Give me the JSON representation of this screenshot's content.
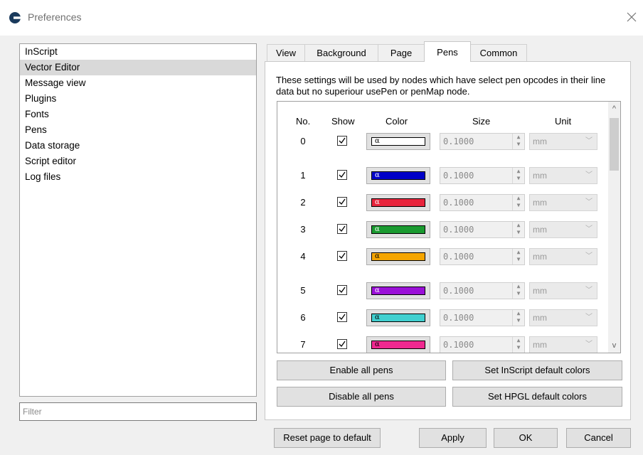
{
  "window": {
    "title": "Preferences"
  },
  "sidebar": {
    "items": [
      {
        "label": "InScript"
      },
      {
        "label": "Vector Editor",
        "selected": true
      },
      {
        "label": "Message view"
      },
      {
        "label": "Plugins"
      },
      {
        "label": "Fonts"
      },
      {
        "label": "Pens"
      },
      {
        "label": "Data storage"
      },
      {
        "label": "Script editor"
      },
      {
        "label": "Log files"
      }
    ],
    "filter_placeholder": "Filter"
  },
  "tabs": [
    {
      "label": "View"
    },
    {
      "label": "Background"
    },
    {
      "label": "Page"
    },
    {
      "label": "Pens",
      "active": true
    },
    {
      "label": "Common"
    }
  ],
  "pens_tab": {
    "description": "These settings will be used by nodes which have select pen opcodes in their line data but no superiour usePen or penMap node.",
    "headers": {
      "no": "No.",
      "show": "Show",
      "color": "Color",
      "size": "Size",
      "unit": "Unit"
    },
    "alpha_glyph": "α",
    "rows": [
      {
        "no": "0",
        "show": true,
        "color": "#ffffff",
        "size": "0.1000",
        "unit": "mm"
      },
      {
        "no": "1",
        "show": true,
        "color": "#0000c8",
        "size": "0.1000",
        "unit": "mm"
      },
      {
        "no": "2",
        "show": true,
        "color": "#e8243c",
        "size": "0.1000",
        "unit": "mm"
      },
      {
        "no": "3",
        "show": true,
        "color": "#1a9a30",
        "size": "0.1000",
        "unit": "mm"
      },
      {
        "no": "4",
        "show": true,
        "color": "#f5a500",
        "size": "0.1000",
        "unit": "mm"
      },
      {
        "no": "5",
        "show": true,
        "color": "#9a10d8",
        "size": "0.1000",
        "unit": "mm"
      },
      {
        "no": "6",
        "show": true,
        "color": "#40d0d0",
        "size": "0.1000",
        "unit": "mm"
      },
      {
        "no": "7",
        "show": true,
        "color": "#f02890",
        "size": "0.1000",
        "unit": "mm"
      }
    ],
    "buttons": {
      "enable_all": "Enable all pens",
      "disable_all": "Disable all pens",
      "inscript_colors": "Set InScript default colors",
      "hpgl_colors": "Set HPGL default colors"
    }
  },
  "footer": {
    "reset": "Reset page to default",
    "apply": "Apply",
    "ok": "OK",
    "cancel": "Cancel"
  }
}
